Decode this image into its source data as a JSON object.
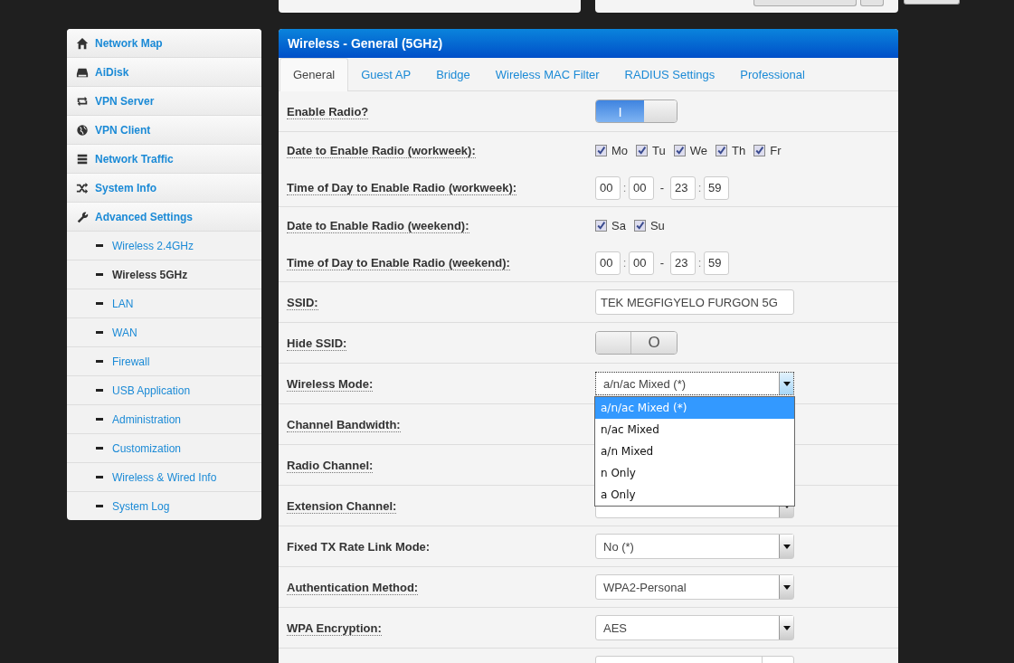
{
  "sidebar": {
    "items": [
      {
        "label": "Network Map",
        "selected": false
      },
      {
        "label": "AiDisk",
        "selected": false
      },
      {
        "label": "VPN Server",
        "selected": false
      },
      {
        "label": "VPN Client",
        "selected": false
      },
      {
        "label": "Network Traffic",
        "selected": false
      },
      {
        "label": "System Info",
        "selected": false
      },
      {
        "label": "Advanced Settings",
        "selected": false,
        "children": [
          {
            "label": "Wireless 2.4GHz",
            "selected": false
          },
          {
            "label": "Wireless 5GHz",
            "selected": true
          },
          {
            "label": "LAN",
            "selected": false
          },
          {
            "label": "WAN",
            "selected": false
          },
          {
            "label": "Firewall",
            "selected": false
          },
          {
            "label": "USB Application",
            "selected": false
          },
          {
            "label": "Administration",
            "selected": false
          },
          {
            "label": "Customization",
            "selected": false
          },
          {
            "label": "Wireless & Wired Info",
            "selected": false
          },
          {
            "label": "System Log",
            "selected": false
          }
        ]
      }
    ]
  },
  "panel": {
    "title": "Wireless - General (5GHz)",
    "tabs": [
      {
        "label": "General",
        "selected": true
      },
      {
        "label": "Guest AP",
        "selected": false
      },
      {
        "label": "Bridge",
        "selected": false
      },
      {
        "label": "Wireless MAC Filter",
        "selected": false
      },
      {
        "label": "RADIUS Settings",
        "selected": false
      },
      {
        "label": "Professional",
        "selected": false
      }
    ],
    "rows": [
      {
        "kind": "toggle",
        "label": "Enable Radio?",
        "hint": true,
        "on": true,
        "symbol": "I"
      },
      {
        "kind": "checkboxes",
        "label": "Date to Enable Radio (workweek):",
        "hint": true,
        "boxes": [
          {
            "label": "Mo",
            "checked": true
          },
          {
            "label": "Tu",
            "checked": true
          },
          {
            "label": "We",
            "checked": true
          },
          {
            "label": "Th",
            "checked": true
          },
          {
            "label": "Fr",
            "checked": true
          }
        ]
      },
      {
        "kind": "time",
        "label": "Time of Day to Enable Radio (workweek):",
        "hint": true,
        "from": [
          "00",
          "00"
        ],
        "to": [
          "23",
          "59"
        ],
        "separator": ":",
        "dash": "-"
      },
      {
        "kind": "checkboxes",
        "label": "Date to Enable Radio (weekend):",
        "hint": true,
        "boxes": [
          {
            "label": "Sa",
            "checked": true
          },
          {
            "label": "Su",
            "checked": true
          }
        ]
      },
      {
        "kind": "time",
        "label": "Time of Day to Enable Radio (weekend):",
        "hint": true,
        "from": [
          "00",
          "00"
        ],
        "to": [
          "23",
          "59"
        ],
        "separator": ":",
        "dash": "-"
      },
      {
        "kind": "text",
        "label": "SSID:",
        "hint": true,
        "value": "TEK MEGFIGYELO FURGON 5G"
      },
      {
        "kind": "toggle",
        "label": "Hide SSID:",
        "hint": true,
        "on": false,
        "symbol": "O"
      },
      {
        "kind": "select",
        "label": "Wireless Mode:",
        "hint": true,
        "value": "a/n/ac Mixed (*)",
        "open": true,
        "options": [
          {
            "label": "a/n/ac Mixed (*)",
            "selected": true
          },
          {
            "label": "n/ac Mixed",
            "selected": false
          },
          {
            "label": "a/n Mixed",
            "selected": false
          },
          {
            "label": "n Only",
            "selected": false
          },
          {
            "label": "a Only",
            "selected": false
          }
        ]
      },
      {
        "kind": "none",
        "label": "Channel Bandwidth:",
        "hint": true
      },
      {
        "kind": "none",
        "label": "Radio Channel:",
        "hint": true
      },
      {
        "kind": "select",
        "label": "Extension Channel:",
        "hint": true,
        "open": false
      },
      {
        "kind": "select",
        "label": "Fixed TX Rate Link Mode:",
        "hint": false,
        "value": "No (*)",
        "open": false
      },
      {
        "kind": "select",
        "label": "Authentication Method:",
        "hint": true,
        "value": "WPA2-Personal",
        "open": false
      },
      {
        "kind": "select",
        "label": "WPA Encryption:",
        "hint": true,
        "value": "AES",
        "open": false
      },
      {
        "kind": "field"
      }
    ]
  }
}
